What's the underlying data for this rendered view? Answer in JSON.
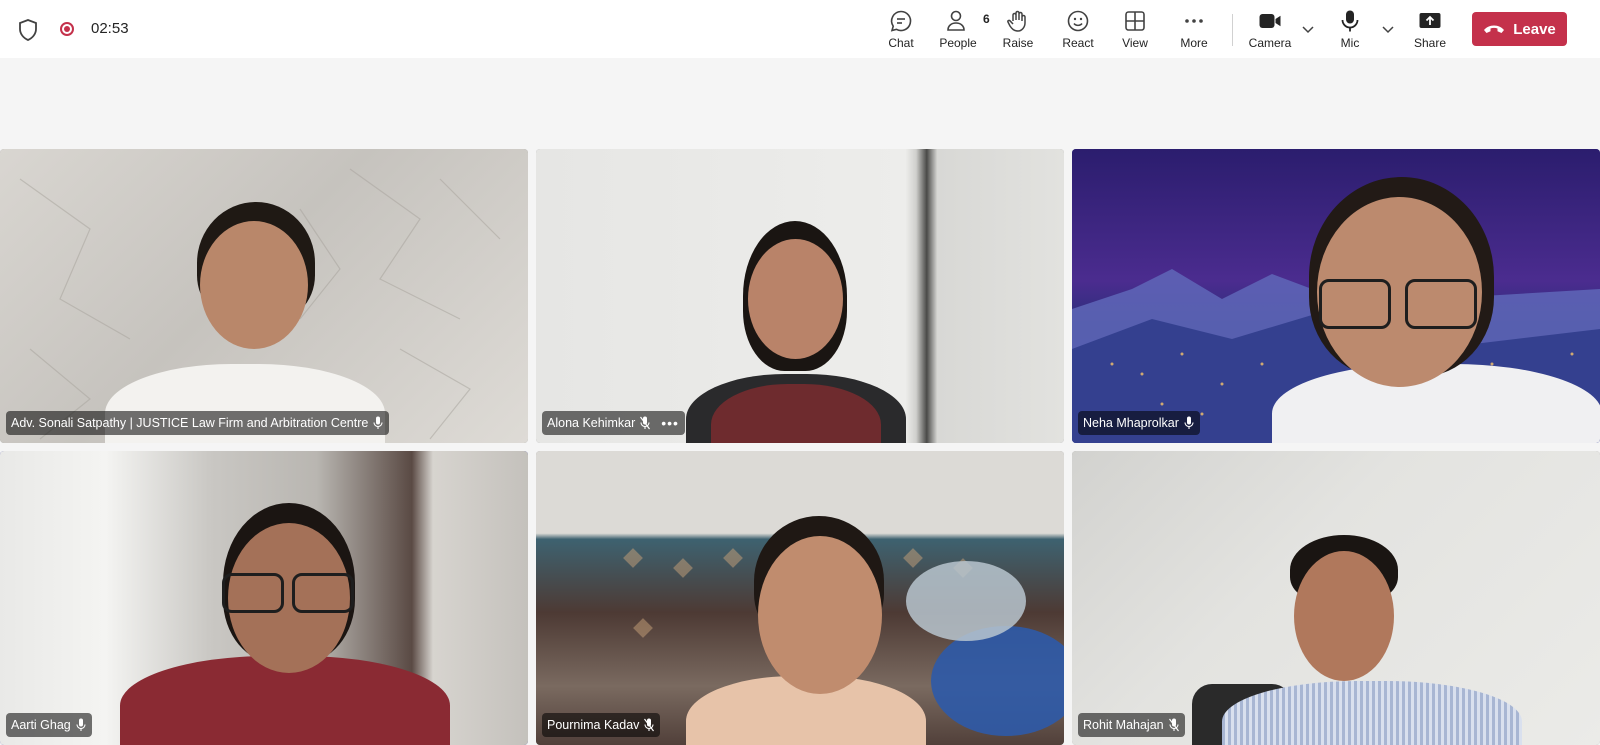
{
  "meeting": {
    "timer": "02:53",
    "recording": true
  },
  "toolbar": {
    "chat_label": "Chat",
    "people_label": "People",
    "people_count": "6",
    "raise_label": "Raise",
    "react_label": "React",
    "view_label": "View",
    "more_label": "More",
    "camera_label": "Camera",
    "mic_label": "Mic",
    "share_label": "Share",
    "leave_label": "Leave"
  },
  "participants": [
    {
      "name": "Adv. Sonali Satpathy | JUSTICE Law Firm and Arbitration Centre",
      "mic": "unmuted",
      "active": false
    },
    {
      "name": "Alona Kehimkar",
      "mic": "muted",
      "active": false
    },
    {
      "name": "Neha Mhaprolkar",
      "mic": "unmuted",
      "active": true
    },
    {
      "name": "Aarti Ghag",
      "mic": "unmuted",
      "active": true
    },
    {
      "name": "Pournima Kadav",
      "mic": "muted",
      "active": false
    },
    {
      "name": "Rohit Mahajan",
      "mic": "muted",
      "active": false
    }
  ],
  "colors": {
    "accent": "#5b5fc7",
    "leave": "#c4314b",
    "recording": "#c4314b"
  },
  "icons": [
    "shield-icon",
    "record-icon",
    "chat-icon",
    "people-icon",
    "raise-hand-icon",
    "react-icon",
    "view-icon",
    "more-icon",
    "camera-icon",
    "mic-icon",
    "share-icon",
    "phone-hangup-icon",
    "chevron-down-icon"
  ]
}
